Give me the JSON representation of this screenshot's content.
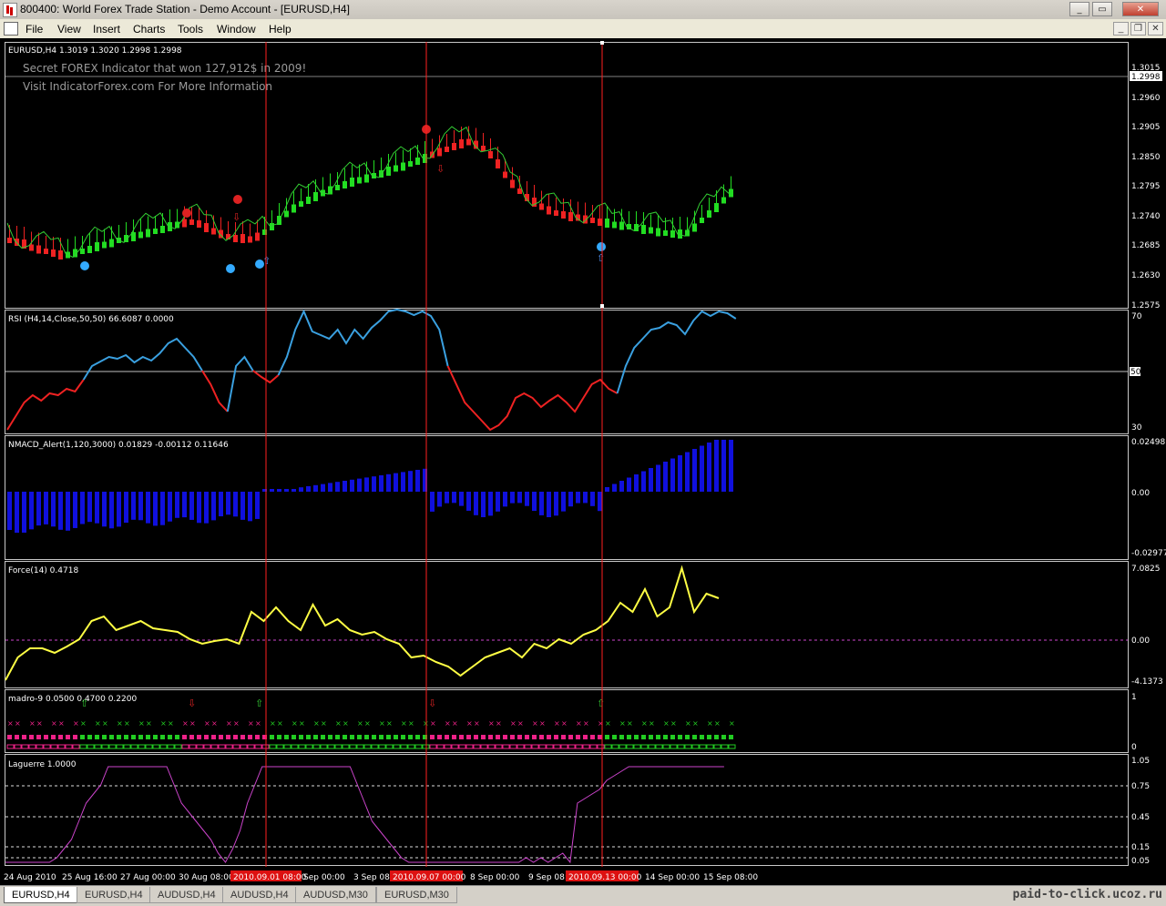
{
  "window": {
    "title": "800400: World Forex Trade Station - Demo Account - [EURUSD,H4]"
  },
  "menu": [
    "File",
    "View",
    "Insert",
    "Charts",
    "Tools",
    "Window",
    "Help"
  ],
  "main_panel": {
    "header": "EURUSD,H4  1.3019 1.3020 1.2998 1.2998",
    "ad_line1": "Secret FOREX Indicator that won 127,912$ in 2009!",
    "ad_line2": "Visit IndicatorForex.com For More Information",
    "price_labels": [
      "1.3015",
      "1.2960",
      "1.2905",
      "1.2850",
      "1.2795",
      "1.2740",
      "1.2685",
      "1.2630",
      "1.2575"
    ],
    "current_price": "1.2998"
  },
  "rsi_panel": {
    "header": "RSI (H4,14,Close,50,50) 66.6087 0.0000",
    "levels": [
      "70",
      "50",
      "30"
    ]
  },
  "nmacd_panel": {
    "header": "NMACD_Alert(1,120,3000) 0.01829 -0.00112 0.11646",
    "levels": [
      "0.02498",
      "0.00",
      "-0.02977"
    ]
  },
  "force_panel": {
    "header": "Force(14) 0.4718",
    "levels": [
      "7.0825",
      "0.00",
      "-4.1373"
    ]
  },
  "madro_panel": {
    "header": "madro-9 0.0500 0.4700 0.2200",
    "levels": [
      "1",
      "0"
    ]
  },
  "laguerre_panel": {
    "header": "Laguerre 1.0000",
    "levels": [
      "1.05",
      "0.75",
      "0.45",
      "0.15",
      "0.05"
    ]
  },
  "time_axis": [
    "24 Aug 2010",
    "25 Aug 16:00",
    "27 Aug 00:00",
    "30 Aug 08:00",
    "Sep 00:00",
    "3 Sep 08:",
    "8 Sep 00:00",
    "9 Sep 08:",
    "14 Sep 00:00",
    "15 Sep 08:00"
  ],
  "time_markers": [
    "2010.09.01 08:00",
    "2010.09.07 00:00",
    "2010.09.13 00:00"
  ],
  "tabs": [
    "EURUSD,H4",
    "EURUSD,H4",
    "AUDUSD,H4",
    "AUDUSD,H4",
    "AUDUSD,M30",
    "EURUSD,M30"
  ],
  "watermark": "paid-to-click.ucoz.ru",
  "colors": {
    "bull": "#22dd22",
    "bear": "#ee2222",
    "rsi_up": "#3aa0e0",
    "macd": "#1010dd",
    "force": "#ffff44",
    "laguerre": "#cc44cc",
    "vline": "#ff2020"
  }
}
